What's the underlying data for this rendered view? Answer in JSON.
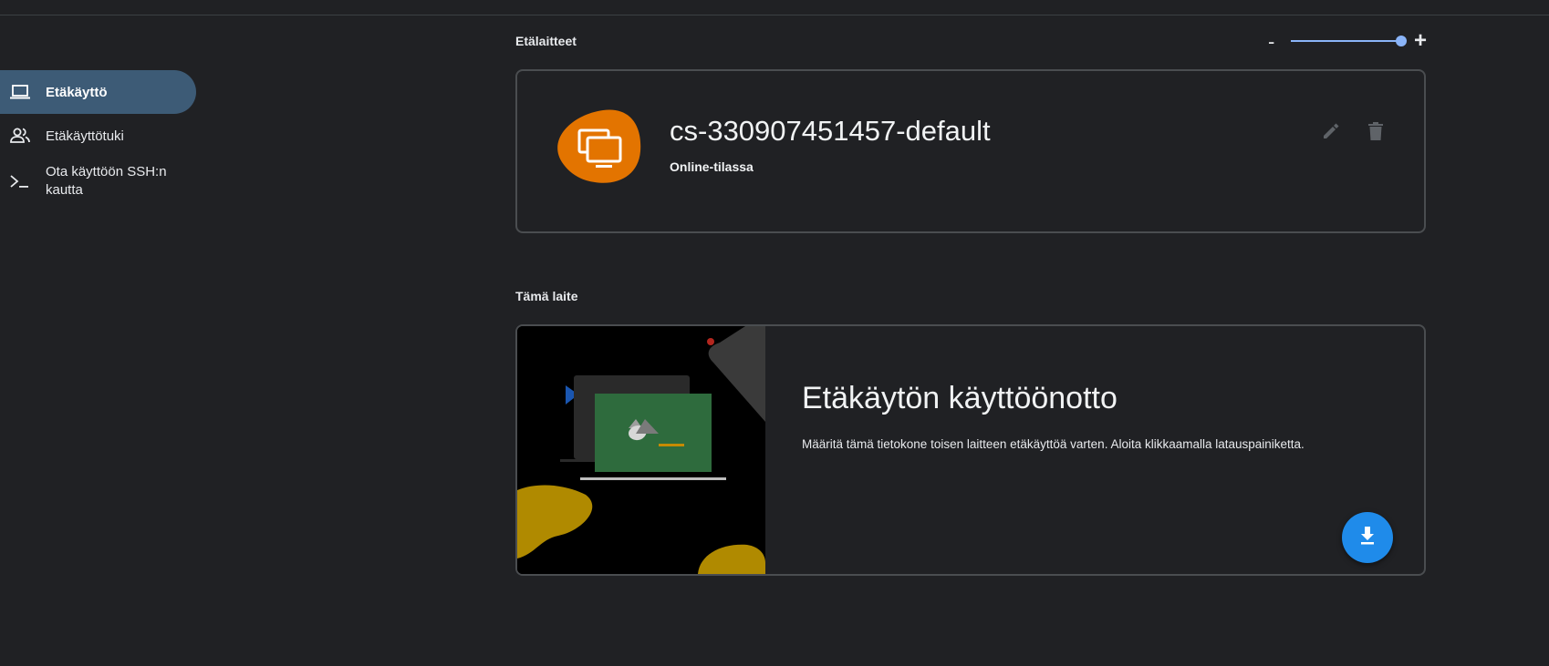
{
  "sidebar": {
    "items": [
      {
        "label": "Etäkäyttö",
        "icon": "laptop-icon",
        "active": true
      },
      {
        "label": "Etäkäyttötuki",
        "icon": "people-icon",
        "active": false
      },
      {
        "label": "Ota käyttöön SSH:n kautta",
        "icon": "terminal-icon",
        "active": false
      }
    ]
  },
  "remote_devices": {
    "title": "Etälaitteet",
    "zoom": {
      "minus": "-",
      "plus": "+",
      "value": 1.0
    },
    "devices": [
      {
        "name": "cs-330907451457-default",
        "status": "Online-tilassa",
        "icon": "remote-desktop-icon",
        "accent": "#e37400"
      }
    ]
  },
  "this_device": {
    "title": "Tämä laite",
    "setup_title": "Etäkäytön käyttöönotto",
    "setup_description": "Määritä tämä tietokone toisen laitteen etäkäyttöä varten. Aloita klikkaamalla latauspainiketta.",
    "download_button_icon": "download-icon",
    "accent": "#1f8bea"
  }
}
